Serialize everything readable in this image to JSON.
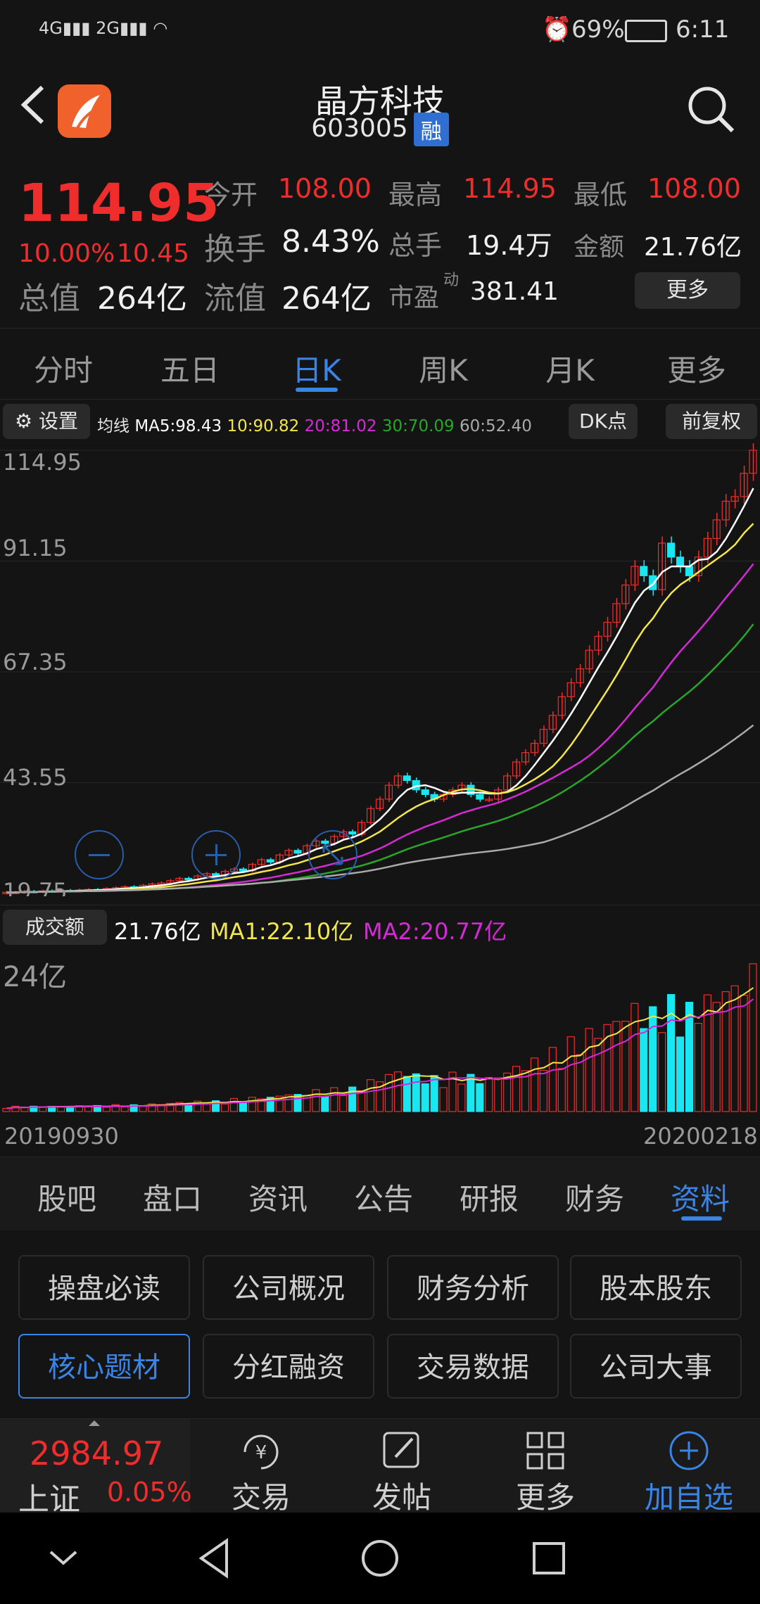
{
  "status": {
    "signal": "4G 2G",
    "battery": "69%",
    "time": "6:11"
  },
  "stock": {
    "name": "晶方科技",
    "code": "603005",
    "badge": "融",
    "price": "114.95",
    "change_pct": "10.00%",
    "change": "10.45",
    "open_label": "今开",
    "open": "108.00",
    "high_label": "最高",
    "high": "114.95",
    "low_label": "最低",
    "low": "108.00",
    "turnover_label": "换手",
    "turnover": "8.43%",
    "volume_label": "总手",
    "volume": "19.4万",
    "amount_label": "金额",
    "amount": "21.76亿",
    "mktcap_label": "总值",
    "mktcap": "264亿",
    "float_label": "流值",
    "float": "264亿",
    "pe_label": "市盈",
    "pe_sup": "动",
    "pe": "381.41",
    "more_label": "更多"
  },
  "period_tabs": [
    "分时",
    "五日",
    "日K",
    "周K",
    "月K",
    "更多"
  ],
  "ma_bar": {
    "settings": "设置",
    "prefix": "均线",
    "ma5": "MA5:98.43",
    "ma10": "10:90.82",
    "ma20": "20:81.02",
    "ma30": "30:70.09",
    "ma60": "60:52.40",
    "dk": "DK点",
    "adjust": "前复权"
  },
  "price_axis": [
    "114.95",
    "91.15",
    "67.35",
    "43.55",
    "19.75"
  ],
  "volume_bar": {
    "label": "成交额",
    "value": "21.76亿",
    "ma1": "MA1:22.10亿",
    "ma2": "MA2:20.77亿",
    "axis_top": "24亿"
  },
  "date_start": "20190930",
  "date_end": "20200218",
  "colors": {
    "up": "#ef2d2d",
    "down": "#19e6f0",
    "ma5": "#ffffff",
    "ma10": "#f2e64a",
    "ma20": "#d62ad6",
    "ma30": "#2aa62a",
    "ma60": "#aaaaaa",
    "accent": "#3a84e6"
  },
  "info_tabs": [
    "股吧",
    "盘口",
    "资讯",
    "公告",
    "研报",
    "财务",
    "资料"
  ],
  "info_cards": [
    "操盘必读",
    "公司概况",
    "财务分析",
    "股本股东",
    "核心题材",
    "分红融资",
    "交易数据",
    "公司大事"
  ],
  "bottom_bar": {
    "index_value": "2984.97",
    "index_name": "上证",
    "index_change": "0.05%",
    "trade": "交易",
    "post": "发帖",
    "more": "更多",
    "add": "加自选"
  },
  "chart_data": {
    "type": "candlestick",
    "ylim": [
      19.75,
      114.95
    ],
    "x_start": "20190930",
    "x_end": "20200218",
    "close_approx": [
      20,
      20,
      20.2,
      20.1,
      20.3,
      20.2,
      20.4,
      20.3,
      20.5,
      20.6,
      20.5,
      20.8,
      21,
      21.2,
      21,
      21.5,
      21.8,
      22,
      22.5,
      23,
      22.8,
      23.5,
      24,
      23.6,
      24.5,
      25,
      24.6,
      26,
      27,
      26.5,
      28,
      29,
      28.4,
      30,
      31,
      30.5,
      32,
      33,
      32.5,
      35,
      38,
      40,
      43,
      45,
      44,
      42,
      41,
      40,
      41,
      42,
      43,
      41,
      40,
      40,
      42,
      45,
      48,
      50,
      52,
      55,
      58,
      62,
      65,
      68,
      72,
      75,
      78,
      82,
      86,
      90,
      88,
      85,
      95,
      92,
      90,
      88,
      92,
      96,
      100,
      104,
      105,
      110,
      114.95
    ],
    "ma5_last": 98.43,
    "ma10_last": 90.82,
    "ma20_last": 81.02,
    "ma30_last": 70.09,
    "ma60_last": 52.4,
    "volume_ylim": [
      0,
      24
    ],
    "volume_ma1_last": 22.1,
    "volume_ma2_last": 20.77
  }
}
